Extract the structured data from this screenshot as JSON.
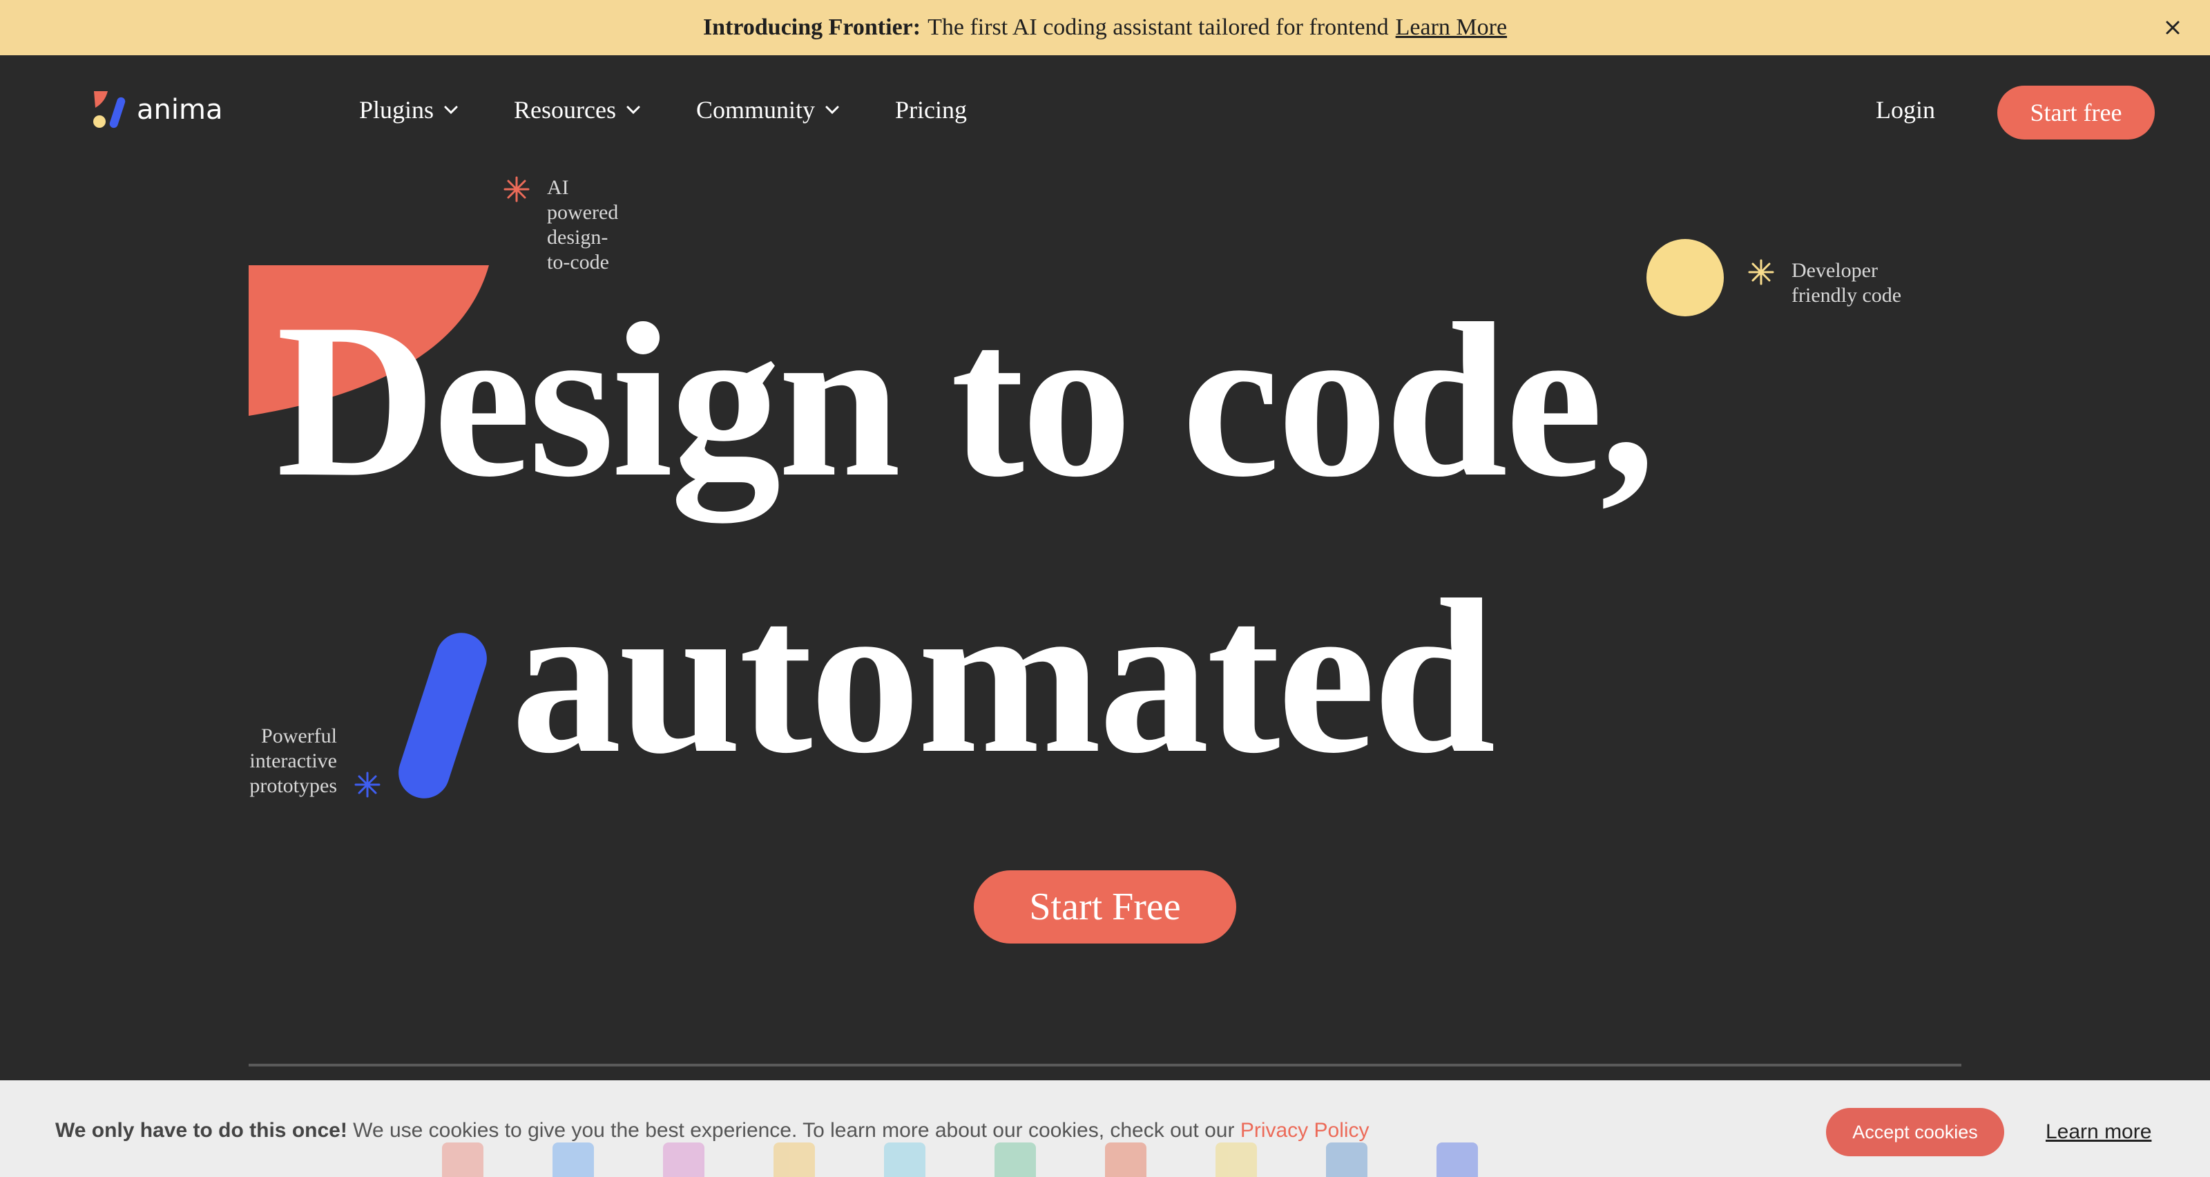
{
  "announcement": {
    "bold": "Introducing Frontier:",
    "text": "The first AI coding assistant tailored for frontend",
    "link": "Learn More"
  },
  "nav": {
    "logo_text": "anima",
    "menu": [
      {
        "label": "Plugins",
        "has_dropdown": true
      },
      {
        "label": "Resources",
        "has_dropdown": true
      },
      {
        "label": "Community",
        "has_dropdown": true
      },
      {
        "label": "Pricing",
        "has_dropdown": false
      }
    ],
    "login": "Login",
    "start_free": "Start free"
  },
  "hero": {
    "line1": "Design to code,",
    "line2": "automated",
    "tags": {
      "ai": [
        "AI",
        "powered",
        "design-",
        "to-code"
      ],
      "dev": [
        "Developer",
        "friendly code"
      ],
      "proto": [
        "Powerful",
        "interactive",
        "prototypes"
      ]
    },
    "cta": "Start Free"
  },
  "colors": {
    "accent": "#ec6b59",
    "yellow": "#f8dc8c",
    "blue": "#3f5ef0",
    "background": "#2a2a2a",
    "announcement_bg": "#f5d896"
  },
  "cookie": {
    "bold": "We only have to do this once!",
    "text": "We use cookies to give you the best experience. To learn more about our cookies, check out our",
    "privacy_link": "Privacy Policy",
    "accept": "Accept cookies",
    "learn_more": "Learn more"
  }
}
